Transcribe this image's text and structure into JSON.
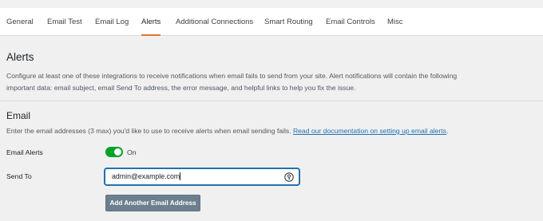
{
  "tabs": [
    {
      "label": "General",
      "active": false
    },
    {
      "label": "Email Test",
      "active": false
    },
    {
      "label": "Email Log",
      "active": false
    },
    {
      "label": "Alerts",
      "active": true
    },
    {
      "label": "Additional Connections",
      "active": false
    },
    {
      "label": "Smart Routing",
      "active": false
    },
    {
      "label": "Email Controls",
      "active": false
    },
    {
      "label": "Misc",
      "active": false
    }
  ],
  "alerts": {
    "title": "Alerts",
    "description_line1": "Configure at least one of these integrations to receive notifications when email fails to send from your site. Alert notifications will contain the following",
    "description_line2": "important data: email subject, email Send To address, the error message, and helpful links to help you fix the issue."
  },
  "email": {
    "title": "Email",
    "description": "Enter the email addresses (3 max) you'd like to use to receive alerts when email sending fails. ",
    "doc_link": "Read our documentation on setting up email alerts",
    "doc_link_suffix": ".",
    "alerts_label": "Email Alerts",
    "toggle_state": "On",
    "send_to_label": "Send To",
    "send_to_value": "admin@example.com",
    "add_button": "Add Another Email Address"
  },
  "colors": {
    "accent_tab": "#e27730",
    "toggle_on": "#00a32a",
    "link": "#2271b1",
    "button": "#6c7f8e"
  },
  "icons": {
    "input_icon": "password-manager-icon"
  }
}
